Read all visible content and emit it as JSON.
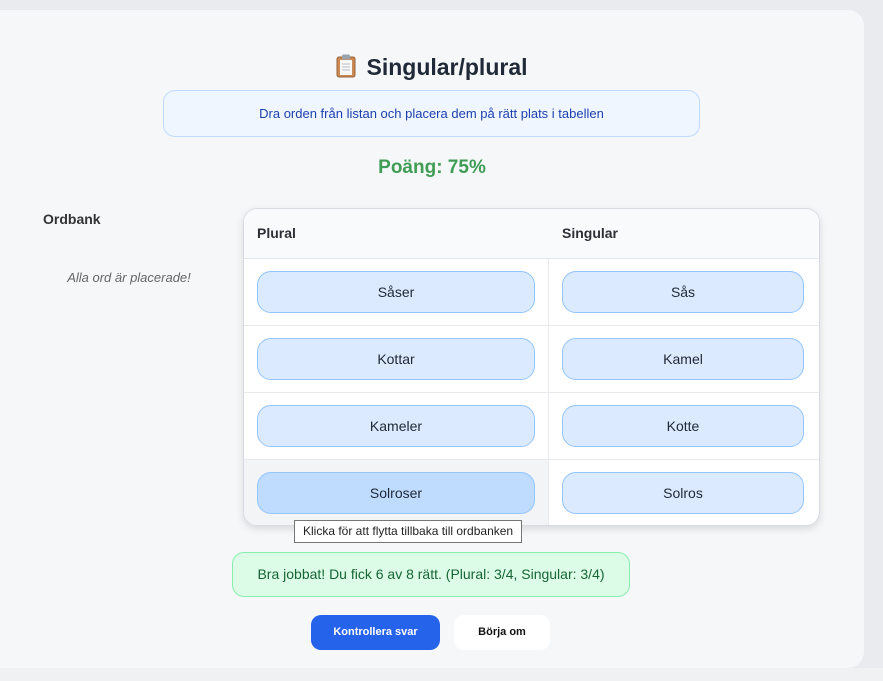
{
  "header": {
    "title": "Singular/plural",
    "icon": "clipboard-icon",
    "instructions": "Dra orden från listan och placera dem på rätt plats i tabellen"
  },
  "score": {
    "text": "Poäng: 75%"
  },
  "word_bank": {
    "title": "Ordbank",
    "empty_message": "Alla ord är placerade!"
  },
  "table": {
    "columns": [
      "Plural",
      "Singular"
    ],
    "rows": [
      {
        "plural": "Såser",
        "singular": "Sås"
      },
      {
        "plural": "Kottar",
        "singular": "Kamel"
      },
      {
        "plural": "Kameler",
        "singular": "Kotte"
      },
      {
        "plural": "Solroser",
        "singular": "Solros"
      }
    ]
  },
  "tooltip": {
    "text": "Klicka för att flytta tillbaka till ordbanken"
  },
  "feedback": {
    "text": "Bra jobbat! Du fick 6 av 8 rätt. (Plural: 3/4, Singular: 3/4)"
  },
  "buttons": {
    "check_label": "Kontrollera svar",
    "reset_label": "Börja om"
  },
  "colors": {
    "accent": "#2563eb",
    "score": "#3f9d55",
    "chip": "#dbeafe",
    "feedback_bg": "#dcfce7"
  }
}
